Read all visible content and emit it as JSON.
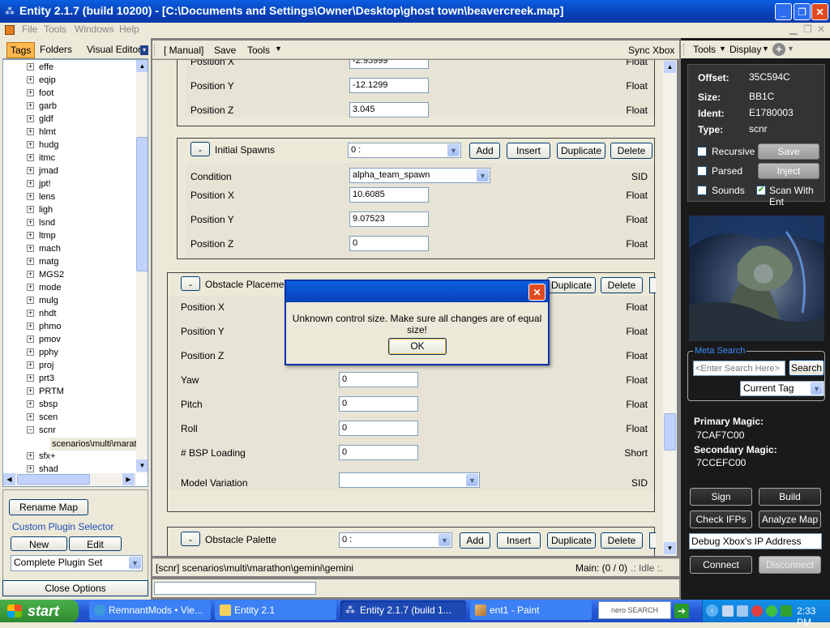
{
  "window": {
    "title": "Entity  2.1.7 (build 10200) - [C:\\Documents and Settings\\Owner\\Desktop\\ghost town\\beavercreek.map]"
  },
  "menubar": {
    "items": [
      "File",
      "Tools",
      "Windows",
      "Help"
    ]
  },
  "left_panel": {
    "tabs": [
      "Tags",
      "Folders",
      "Visual Editor"
    ],
    "tree": [
      "effe",
      "eqip",
      "foot",
      "garb",
      "gldf",
      "hlmt",
      "hudg",
      "itmc",
      "jmad",
      "jpt!",
      "lens",
      "ligh",
      "lsnd",
      "ltmp",
      "mach",
      "matg",
      "MGS2",
      "mode",
      "mulg",
      "nhdt",
      "phmo",
      "pmov",
      "pphy",
      "proj",
      "prt3",
      "PRTM",
      "sbsp",
      "scen",
      "scnr"
    ],
    "tree_selected": "scenarios\\multi\\marath",
    "tree_after": [
      "sfx+",
      "shad"
    ],
    "rename_map": "Rename Map",
    "custom_plugin_selector": "Custom Plugin Selector",
    "new_button": "New",
    "edit_button": "Edit",
    "plugin_set": "Complete Plugin Set",
    "close_options": "Close Options"
  },
  "toolbar": {
    "manual": "[ Manual]",
    "save": "Save",
    "tools": "Tools",
    "sync_xbox": "Sync Xbox"
  },
  "meta": {
    "top_fields": [
      {
        "label": "Position X",
        "value": "-2.95999",
        "type": "Float"
      },
      {
        "label": "Position Y",
        "value": "-12.1299",
        "type": "Float"
      },
      {
        "label": "Position Z",
        "value": "3.045",
        "type": "Float"
      }
    ],
    "initial_spawns": {
      "minus": "-",
      "title": "Initial Spawns",
      "index": "0 :",
      "add": "Add",
      "insert": "Insert",
      "duplicate": "Duplicate",
      "delete": "Delete",
      "condition_label": "Condition",
      "condition_value": "alpha_team_spawn",
      "condition_type": "SID",
      "fields": [
        {
          "label": "Position X",
          "value": "10.6085",
          "type": "Float"
        },
        {
          "label": "Position Y",
          "value": "9.07523",
          "type": "Float"
        },
        {
          "label": "Position Z",
          "value": "0",
          "type": "Float"
        }
      ]
    },
    "obstacle_placement": {
      "minus": "-",
      "title": "Obstacle Placemen",
      "duplicate": "Duplicate",
      "delete": "Delete",
      "fields": [
        {
          "label": "Position X",
          "value": "",
          "type": "Float"
        },
        {
          "label": "Position Y",
          "value": "",
          "type": "Float"
        },
        {
          "label": "Position Z",
          "value": "",
          "type": "Float"
        },
        {
          "label": "Yaw",
          "value": "0",
          "type": "Float"
        },
        {
          "label": "Pitch",
          "value": "0",
          "type": "Float"
        },
        {
          "label": "Roll",
          "value": "0",
          "type": "Float"
        },
        {
          "label": "# BSP Loading",
          "value": "0",
          "type": "Short"
        }
      ],
      "model_variation_label": "Model Variation",
      "model_variation_type": "SID"
    },
    "obstacle_palette": {
      "minus": "-",
      "title": "Obstacle Palette",
      "index": "0 :",
      "add": "Add",
      "insert": "Insert",
      "duplicate": "Duplicate",
      "delete": "Delete"
    }
  },
  "dialog": {
    "message": "Unknown control size. Make sure all changes are of equal size!",
    "ok": "OK"
  },
  "statusbar": {
    "path": "[scnr]  scenarios\\multi\\marathon\\gemini\\gemini",
    "main": "Main: (0 / 0)",
    "idle": ".: Idle :."
  },
  "right_panel": {
    "tools": "Tools",
    "display": "Display",
    "offset_label": "Offset:",
    "offset_value": "35C594C",
    "size_label": "Size:",
    "size_value": "BB1C",
    "ident_label": "Ident:",
    "ident_value": "E1780003",
    "type_label": "Type:",
    "type_value": "scnr",
    "recursive": "Recursive",
    "parsed": "Parsed",
    "sounds": "Sounds",
    "scan_with_ent": "Scan With Ent",
    "save": "Save",
    "inject": "Inject",
    "meta_search_title": "Meta Search",
    "search_placeholder": "<Enter Search Here>",
    "search_button": "Search",
    "current_tag": "Current Tag",
    "primary_magic_label": "Primary Magic:",
    "primary_magic_value": "7CAF7C00",
    "secondary_magic_label": "Secondary Magic:",
    "secondary_magic_value": "7CCEFC00",
    "sign": "Sign",
    "build": "Build",
    "check_ifps": "Check IFPs",
    "analyze_map": "Analyze Map",
    "debug_label": "Debug  Xbox's  IP  Address",
    "connect": "Connect",
    "disconnect": "Disconnect"
  },
  "taskbar": {
    "start": "start",
    "items": [
      "RemnantMods • Vie...",
      "Entity 2.1",
      "Entity  2.1.7 (build 1...",
      "ent1 - Paint"
    ],
    "search_brand": "nero SEARCH",
    "clock": "2:33 PM"
  }
}
